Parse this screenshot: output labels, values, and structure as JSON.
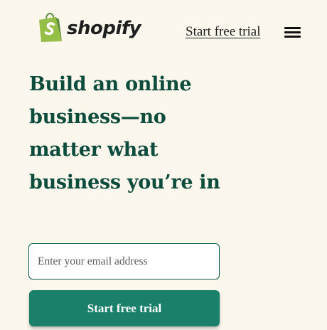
{
  "header": {
    "logo_text": "shopify",
    "cta_link_label": "Start free trial",
    "menu_icon": "hamburger-menu-icon",
    "logo_icon": "shopify-bag-icon"
  },
  "hero": {
    "headline": "Build an online business—no matter what business you’re in"
  },
  "signup": {
    "email_placeholder": "Enter your email address",
    "button_label": "Start free trial"
  },
  "colors": {
    "background": "#fbf7ed",
    "headline": "#0d4b3c",
    "button": "#1b806a",
    "logo_green": "#95bf47"
  }
}
